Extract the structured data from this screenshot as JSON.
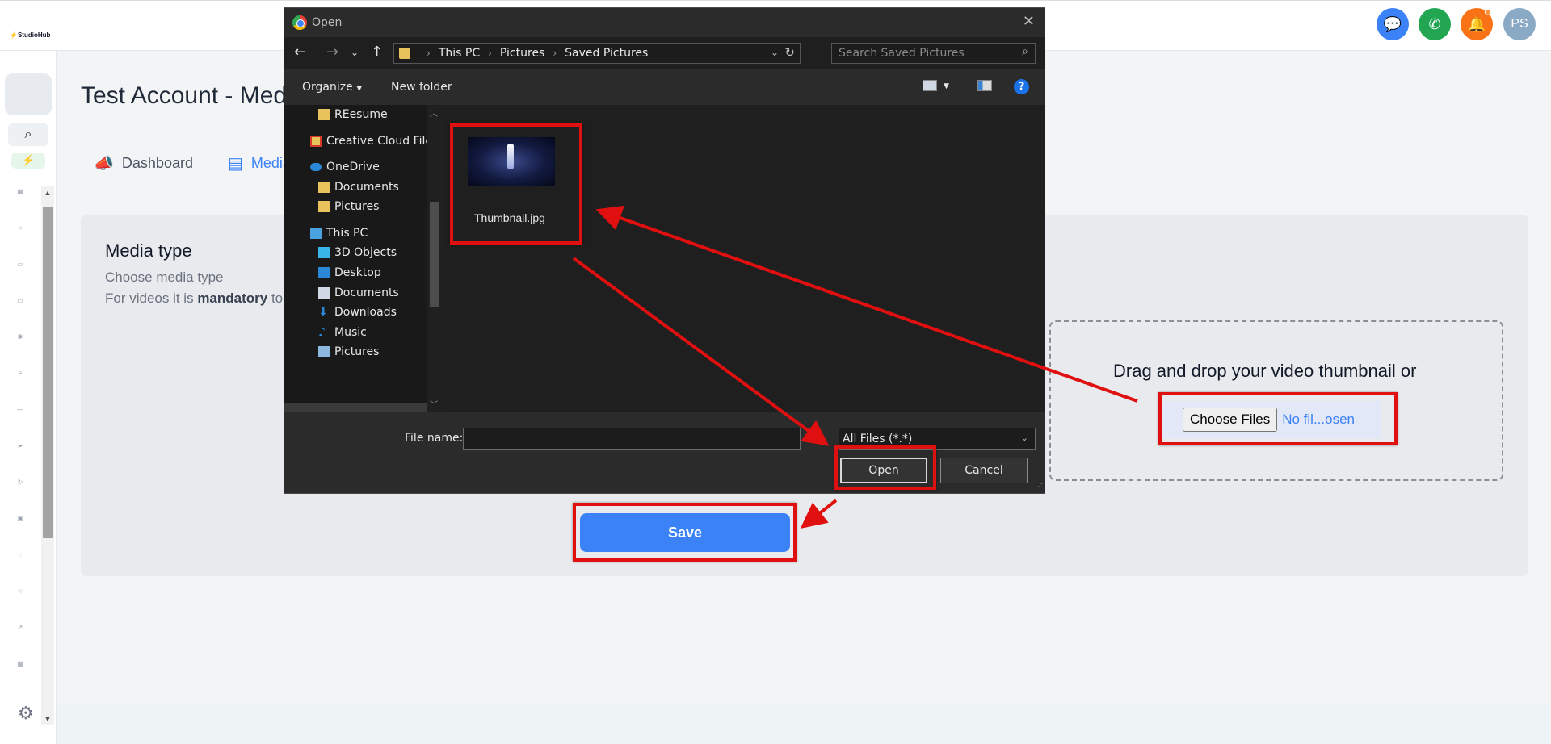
{
  "app": {
    "logo_text": "StudioHub"
  },
  "header": {
    "avatar_initials": "PS"
  },
  "page": {
    "title": "Test Account - Media",
    "tabs": [
      {
        "label": "Dashboard",
        "icon": "megaphone-icon"
      },
      {
        "label": "Media",
        "icon": "box-icon"
      }
    ]
  },
  "card": {
    "heading": "Media type",
    "subtitle": "Choose media type",
    "note_prefix": "For videos it is ",
    "note_bold": "mandatory",
    "note_suffix": " to"
  },
  "dropzone": {
    "text": "Drag and drop your video thumbnail or",
    "choose_label": "Choose Files",
    "no_file_text": "No fil...osen"
  },
  "save_label": "Save",
  "dialog": {
    "title": "Open",
    "breadcrumb": [
      "This PC",
      "Pictures",
      "Saved Pictures"
    ],
    "search_placeholder": "Search Saved Pictures",
    "organize_label": "Organize",
    "new_folder_label": "New folder",
    "help_label": "?",
    "nav_items": [
      {
        "label": "REesume",
        "icon": "folder-icon"
      },
      {
        "label": "Creative Cloud File",
        "icon": "creative-cloud-icon"
      },
      {
        "label": "OneDrive",
        "icon": "cloud-icon"
      },
      {
        "label": "Documents",
        "icon": "folder-icon"
      },
      {
        "label": "Pictures",
        "icon": "folder-icon"
      },
      {
        "label": "This PC",
        "icon": "computer-icon"
      },
      {
        "label": "3D Objects",
        "icon": "cube-icon"
      },
      {
        "label": "Desktop",
        "icon": "desktop-icon"
      },
      {
        "label": "Documents",
        "icon": "document-icon"
      },
      {
        "label": "Downloads",
        "icon": "download-icon"
      },
      {
        "label": "Music",
        "icon": "music-icon"
      },
      {
        "label": "Pictures",
        "icon": "picture-icon"
      }
    ],
    "file": {
      "name": "Thumbnail.jpg"
    },
    "file_name_label": "File name:",
    "file_name_value": "",
    "file_type": "All Files (*.*)",
    "open_label": "Open",
    "cancel_label": "Cancel"
  },
  "colors": {
    "accent": "#3b82f6",
    "annotation": "#e01010",
    "chat": "#3b82f6",
    "phone": "#22a652",
    "bell": "#f97316",
    "avatar": "#8aa9c5"
  }
}
